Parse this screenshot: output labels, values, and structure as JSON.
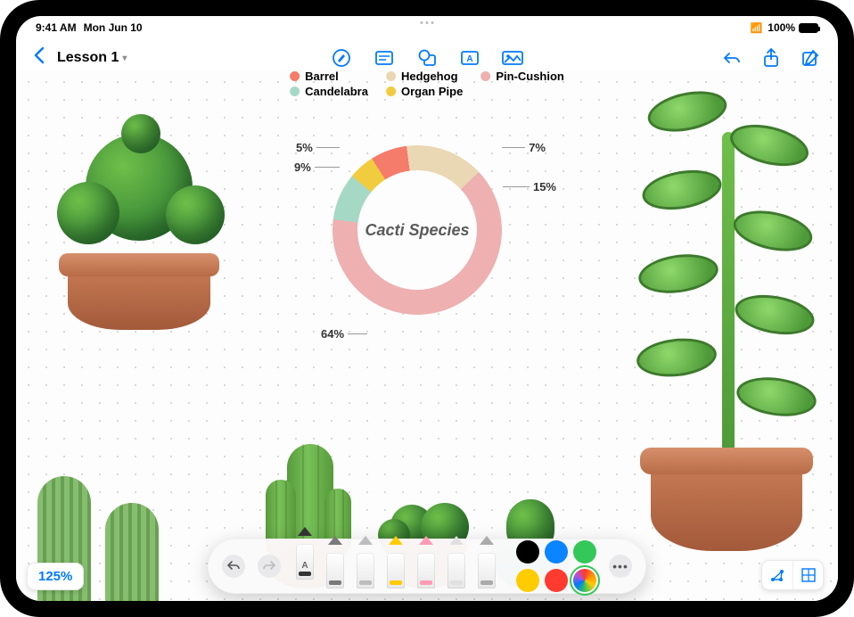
{
  "status": {
    "time": "9:41 AM",
    "date": "Mon Jun 10",
    "battery_pct": "100%"
  },
  "toolbar": {
    "document_title": "Lesson 1",
    "icons": [
      "pen",
      "sticky-note",
      "shape",
      "text-box",
      "media",
      "undo",
      "share",
      "compose"
    ]
  },
  "zoom_label": "125%",
  "chart_data": {
    "type": "pie",
    "title": "Cacti Species",
    "series": [
      {
        "name": "Barrel",
        "value": 7,
        "color": "#f57c6a"
      },
      {
        "name": "Hedgehog",
        "value": 15,
        "color": "#ead7b3"
      },
      {
        "name": "Pin-Cushion",
        "value": 64,
        "color": "#eeb0b0"
      },
      {
        "name": "Candelabra",
        "value": 9,
        "color": "#a6d8c6"
      },
      {
        "name": "Organ Pipe",
        "value": 5,
        "color": "#f2cc3f"
      }
    ],
    "value_suffix": "%",
    "legend_position": "top"
  },
  "tool_tray": {
    "undo_enabled": true,
    "redo_enabled": false,
    "tools": [
      {
        "id": "pen",
        "label": "A",
        "tip": "#333333",
        "selected": true
      },
      {
        "id": "pencil",
        "label": "",
        "tip": "#7a7a7a"
      },
      {
        "id": "brush",
        "label": "",
        "tip": "#bdbdbd"
      },
      {
        "id": "crayon",
        "label": "",
        "tip": "#ffcc00"
      },
      {
        "id": "highlighter",
        "label": "",
        "tip": "#ff9bb3"
      },
      {
        "id": "eraser",
        "label": "",
        "tip": "#e0e0e0"
      },
      {
        "id": "ruler",
        "label": "",
        "tip": "#aaaaaa"
      }
    ],
    "colors": [
      {
        "id": "black",
        "hex": "#000000"
      },
      {
        "id": "blue",
        "hex": "#0a84ff"
      },
      {
        "id": "green",
        "hex": "#34c759"
      },
      {
        "id": "yellow",
        "hex": "#ffcc00"
      },
      {
        "id": "red",
        "hex": "#ff3b30"
      },
      {
        "id": "rainbow",
        "hex": "rainbow",
        "selected": true
      }
    ]
  },
  "view_controls": {
    "left": "graph-view",
    "right": "grid-view"
  }
}
